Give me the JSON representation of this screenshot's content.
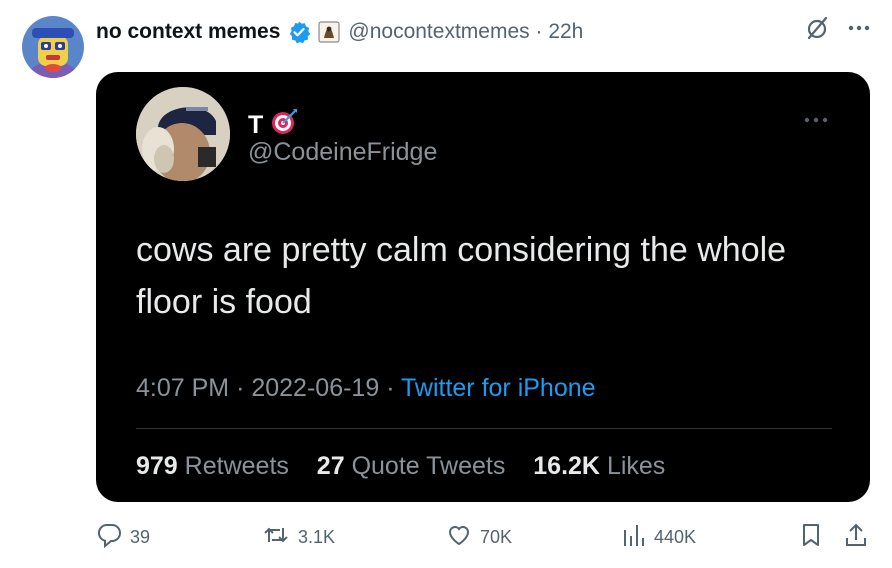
{
  "tweet": {
    "display_name": "no context memes",
    "handle": "@nocontextmemes",
    "separator": "·",
    "time_ago": "22h"
  },
  "quoted": {
    "display_name": "T",
    "handle": "@CodeineFridge",
    "text": "cows are pretty calm considering the whole floor is food",
    "time": "4:07 PM",
    "date": "2022-06-19",
    "source": "Twitter for iPhone",
    "stats": {
      "retweets_count": "979",
      "retweets_label": "Retweets",
      "quotes_count": "27",
      "quotes_label": "Quote Tweets",
      "likes_count": "16.2K",
      "likes_label": "Likes"
    }
  },
  "actions": {
    "replies": "39",
    "retweets": "3.1K",
    "likes": "70K",
    "views": "440K"
  },
  "colors": {
    "verified_blue": "#1d9bf0",
    "secondary_text": "#536471",
    "card_background": "#000000"
  },
  "icons": [
    "grok-icon",
    "more-icon",
    "verified-badge-icon",
    "affiliate-badge-icon",
    "target-emoji-icon",
    "reply-icon",
    "retweet-icon",
    "like-icon",
    "views-icon",
    "bookmark-icon",
    "share-icon"
  ]
}
